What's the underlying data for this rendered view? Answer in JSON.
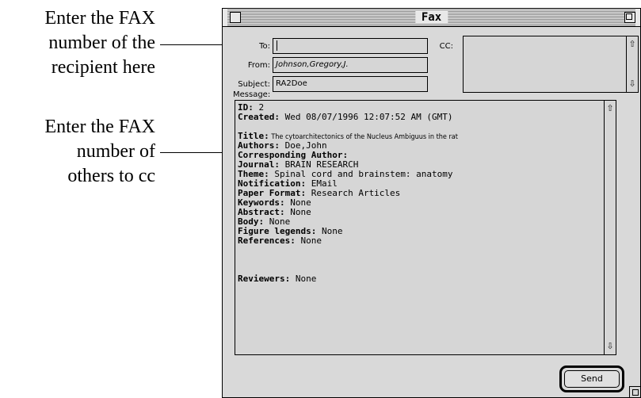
{
  "annotations": {
    "fax_to": [
      "Enter the FAX",
      "number of the",
      "recipient here"
    ],
    "fax_cc": [
      "Enter the FAX",
      "number of",
      "others to cc"
    ]
  },
  "window": {
    "title": "Fax"
  },
  "form": {
    "to_label": "To:",
    "to_value": "",
    "cc_label": "CC:",
    "cc_value": "",
    "from_label": "From:",
    "from_value": "Johnson,Gregory,J.",
    "subject_label": "Subject:",
    "subject_value": "RA2Doe",
    "message_label": "Message:"
  },
  "message": [
    {
      "key": "ID:",
      "value": " 2"
    },
    {
      "key": "Created:",
      "value": " Wed 08/07/1996 12:07:52 AM (GMT)"
    },
    {
      "key": "",
      "value": ""
    },
    {
      "key": "Title:",
      "value": " The cytoarchitectonics of the Nucleus Ambiguus in the rat",
      "small": true
    },
    {
      "key": "Authors:",
      "value": " Doe,John"
    },
    {
      "key": "Corresponding Author:",
      "value": ""
    },
    {
      "key": "Journal:",
      "value": " BRAIN RESEARCH"
    },
    {
      "key": "Theme:",
      "value": " Spinal cord and brainstem: anatomy"
    },
    {
      "key": "Notification:",
      "value": " EMail"
    },
    {
      "key": "Paper Format:",
      "value": " Research Articles"
    },
    {
      "key": "Keywords:",
      "value": " None"
    },
    {
      "key": "Abstract:",
      "value": " None"
    },
    {
      "key": "Body:",
      "value": " None"
    },
    {
      "key": "Figure legends:",
      "value": " None"
    },
    {
      "key": "References:",
      "value": " None"
    },
    {
      "key": "",
      "value": ""
    },
    {
      "key": "",
      "value": ""
    },
    {
      "key": "",
      "value": ""
    },
    {
      "key": "Reviewers:",
      "value": " None"
    }
  ],
  "buttons": {
    "send": "Send"
  },
  "icons": {
    "scroll_up": "up-arrow-icon",
    "scroll_down": "down-arrow-icon",
    "close_box": "close-box-icon",
    "zoom_box": "zoom-box-icon",
    "grow_box": "grow-box-icon"
  }
}
